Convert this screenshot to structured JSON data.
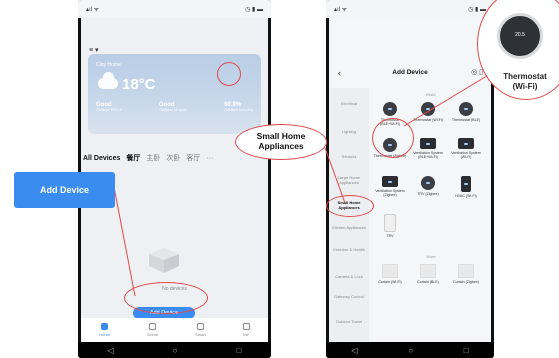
{
  "phone1": {
    "weather": {
      "location": "Cloy Home",
      "temperature": "18°C",
      "stats": [
        {
          "value": "Good",
          "label": "Outdoor PM2.5"
        },
        {
          "value": "Good",
          "label": "Outdoor air quali"
        },
        {
          "value": "60.9%",
          "label": "Outdoor humidity"
        }
      ]
    },
    "tabs": [
      "All Devices",
      "餐厅",
      "主卧",
      "次卧",
      "客厅",
      "···"
    ],
    "empty_label": "No devices",
    "add_device_label": "Add Device",
    "bottom_nav": [
      "Home",
      "Scene",
      "Smart",
      "Me"
    ]
  },
  "phone2": {
    "title": "Add Device",
    "sidebar": [
      "Electrical",
      "Lighting",
      "Sensors",
      "Large Home Appliances",
      "Small Home Appliances",
      "Kitchen Appliances",
      "Exercise & Health",
      "Camera & Lock",
      "Gateway Control",
      "Outdoor Travel"
    ],
    "selected_index": 4,
    "section_hvac": "HVAC",
    "devices": [
      {
        "name": "Thermostat (BLE+Wi-Fi)",
        "thumb": "round"
      },
      {
        "name": "Thermostat (Wi-Fi)",
        "thumb": "round"
      },
      {
        "name": "Thermostat (BLE)",
        "thumb": "round"
      },
      {
        "name": "Thermostat (Zigbee)",
        "thumb": "round"
      },
      {
        "name": "Ventilation System (BLE+Wi-Fi)",
        "thumb": "sq"
      },
      {
        "name": "Ventilation System (Wi-Fi)",
        "thumb": "sq"
      },
      {
        "name": "Ventilation System (Zigbee)",
        "thumb": "sq"
      },
      {
        "name": "TRV (Zigbee)",
        "thumb": "round"
      },
      {
        "name": "HVAC (Wi-Fi)",
        "thumb": "tall"
      },
      {
        "name": "TRV",
        "thumb": "white"
      }
    ],
    "section_more": "More",
    "curtains": [
      {
        "name": "Curtain (Wi-Fi)"
      },
      {
        "name": "Curtain (BLE)"
      },
      {
        "name": "Curtain (Zigbee)"
      }
    ]
  },
  "callouts": {
    "add_device": "Add Device",
    "small_home_appliances": "Small Home Appliances",
    "thermostat_line1": "Thermostat",
    "thermostat_line2": "(Wi-Fi)",
    "thermostat_reading": "20.5"
  },
  "colors": {
    "accent": "#3a8cf0",
    "highlight": "#e04a4a"
  }
}
